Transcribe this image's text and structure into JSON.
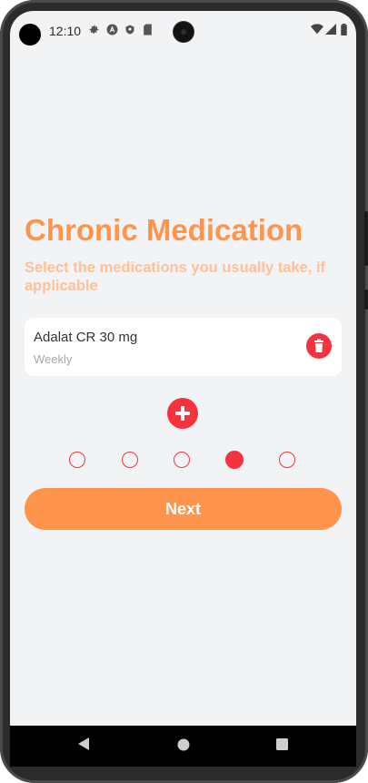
{
  "status_bar": {
    "time": "12:10",
    "left_icons": [
      "gear-icon",
      "a-circle-icon",
      "shield-icon",
      "sd-card-icon"
    ],
    "right_icons": [
      "wifi-icon",
      "signal-icon",
      "battery-icon"
    ]
  },
  "page": {
    "title": "Chronic Medication",
    "subtitle": "Select the medications you usually take, if applicable"
  },
  "medications": [
    {
      "name": "Adalat CR 30 mg",
      "frequency": "Weekly"
    }
  ],
  "pager": {
    "total": 5,
    "active_index": 3
  },
  "buttons": {
    "next": "Next"
  },
  "colors": {
    "accent": "#ff944d",
    "accent_light": "#ffc09a",
    "danger": "#f5333f",
    "background": "#f2f3f5"
  },
  "nav_bar": [
    "back-icon",
    "home-icon",
    "recents-icon"
  ]
}
